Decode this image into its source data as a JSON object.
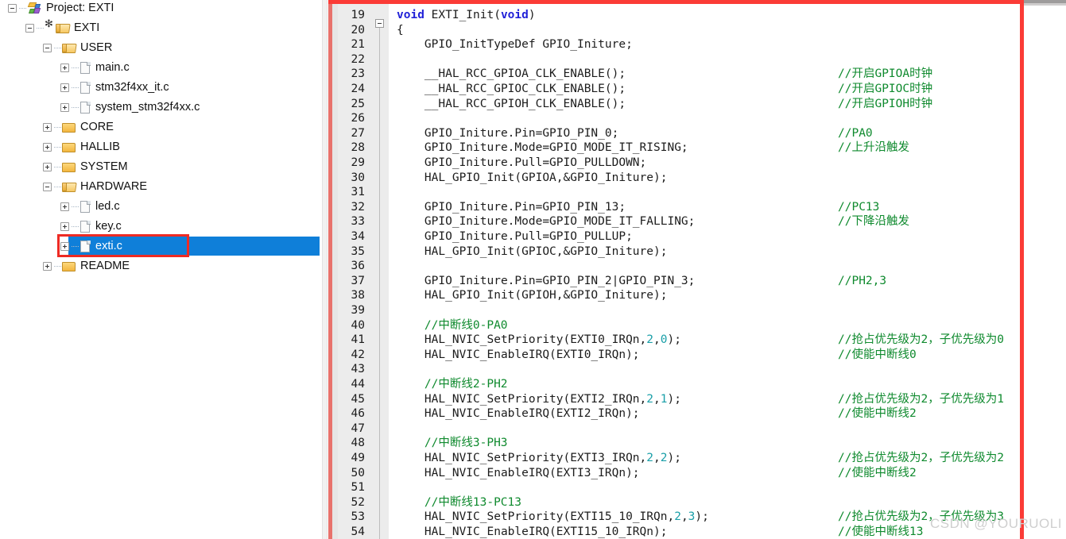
{
  "window": {
    "annotation_color": "#fb3b36",
    "selection_color": "#0f7fd9",
    "watermark": "CSDN @YOURUOLI"
  },
  "tree": {
    "root_label": "Project: EXTI",
    "nodes": [
      {
        "label": "Project: EXTI",
        "icon": "project-icon",
        "depth": 0,
        "expander": "minus",
        "selected": false
      },
      {
        "label": "EXTI",
        "icon": "target-folder-icon",
        "depth": 1,
        "expander": "minus",
        "selected": false
      },
      {
        "label": "USER",
        "icon": "folder-open-icon",
        "depth": 2,
        "expander": "minus",
        "selected": false
      },
      {
        "label": "main.c",
        "icon": "file-icon",
        "depth": 3,
        "expander": "plus",
        "selected": false
      },
      {
        "label": "stm32f4xx_it.c",
        "icon": "file-icon",
        "depth": 3,
        "expander": "plus",
        "selected": false
      },
      {
        "label": "system_stm32f4xx.c",
        "icon": "file-icon",
        "depth": 3,
        "expander": "plus",
        "selected": false
      },
      {
        "label": "CORE",
        "icon": "folder-icon",
        "depth": 2,
        "expander": "plus",
        "selected": false
      },
      {
        "label": "HALLIB",
        "icon": "folder-icon",
        "depth": 2,
        "expander": "plus",
        "selected": false
      },
      {
        "label": "SYSTEM",
        "icon": "folder-icon",
        "depth": 2,
        "expander": "plus",
        "selected": false
      },
      {
        "label": "HARDWARE",
        "icon": "folder-open-icon",
        "depth": 2,
        "expander": "minus",
        "selected": false
      },
      {
        "label": "led.c",
        "icon": "file-icon",
        "depth": 3,
        "expander": "plus",
        "selected": false
      },
      {
        "label": "key.c",
        "icon": "file-icon",
        "depth": 3,
        "expander": "plus",
        "selected": false
      },
      {
        "label": "exti.c",
        "icon": "file-icon",
        "depth": 3,
        "expander": "plus",
        "selected": true
      },
      {
        "label": "README",
        "icon": "folder-icon",
        "depth": 2,
        "expander": "plus",
        "selected": false
      }
    ]
  },
  "editor": {
    "first_line_number": 19,
    "lines": [
      {
        "n": 19,
        "code": "void EXTI_Init(void)",
        "comment": ""
      },
      {
        "n": 20,
        "code": "{",
        "comment": ""
      },
      {
        "n": 21,
        "code": "    GPIO_InitTypeDef GPIO_Initure;",
        "comment": ""
      },
      {
        "n": 22,
        "code": "",
        "comment": ""
      },
      {
        "n": 23,
        "code": "    __HAL_RCC_GPIOA_CLK_ENABLE();",
        "comment": "//开启GPIOA时钟"
      },
      {
        "n": 24,
        "code": "    __HAL_RCC_GPIOC_CLK_ENABLE();",
        "comment": "//开启GPIOC时钟"
      },
      {
        "n": 25,
        "code": "    __HAL_RCC_GPIOH_CLK_ENABLE();",
        "comment": "//开启GPIOH时钟"
      },
      {
        "n": 26,
        "code": "",
        "comment": ""
      },
      {
        "n": 27,
        "code": "    GPIO_Initure.Pin=GPIO_PIN_0;",
        "comment": "//PA0"
      },
      {
        "n": 28,
        "code": "    GPIO_Initure.Mode=GPIO_MODE_IT_RISING;",
        "comment": "//上升沿触发"
      },
      {
        "n": 29,
        "code": "    GPIO_Initure.Pull=GPIO_PULLDOWN;",
        "comment": ""
      },
      {
        "n": 30,
        "code": "    HAL_GPIO_Init(GPIOA,&GPIO_Initure);",
        "comment": ""
      },
      {
        "n": 31,
        "code": "",
        "comment": ""
      },
      {
        "n": 32,
        "code": "    GPIO_Initure.Pin=GPIO_PIN_13;",
        "comment": "//PC13"
      },
      {
        "n": 33,
        "code": "    GPIO_Initure.Mode=GPIO_MODE_IT_FALLING;",
        "comment": "//下降沿触发"
      },
      {
        "n": 34,
        "code": "    GPIO_Initure.Pull=GPIO_PULLUP;",
        "comment": ""
      },
      {
        "n": 35,
        "code": "    HAL_GPIO_Init(GPIOC,&GPIO_Initure);",
        "comment": ""
      },
      {
        "n": 36,
        "code": "",
        "comment": ""
      },
      {
        "n": 37,
        "code": "    GPIO_Initure.Pin=GPIO_PIN_2|GPIO_PIN_3;",
        "comment": "//PH2,3"
      },
      {
        "n": 38,
        "code": "    HAL_GPIO_Init(GPIOH,&GPIO_Initure);",
        "comment": ""
      },
      {
        "n": 39,
        "code": "",
        "comment": ""
      },
      {
        "n": 40,
        "code": "    //中断线0-PA0",
        "comment": ""
      },
      {
        "n": 41,
        "code": "    HAL_NVIC_SetPriority(EXTI0_IRQn,2,0);",
        "comment": "//抢占优先级为2，子优先级为0"
      },
      {
        "n": 42,
        "code": "    HAL_NVIC_EnableIRQ(EXTI0_IRQn);",
        "comment": "//使能中断线0"
      },
      {
        "n": 43,
        "code": "",
        "comment": ""
      },
      {
        "n": 44,
        "code": "    //中断线2-PH2",
        "comment": ""
      },
      {
        "n": 45,
        "code": "    HAL_NVIC_SetPriority(EXTI2_IRQn,2,1);",
        "comment": "//抢占优先级为2，子优先级为1"
      },
      {
        "n": 46,
        "code": "    HAL_NVIC_EnableIRQ(EXTI2_IRQn);",
        "comment": "//使能中断线2"
      },
      {
        "n": 47,
        "code": "",
        "comment": ""
      },
      {
        "n": 48,
        "code": "    //中断线3-PH3",
        "comment": ""
      },
      {
        "n": 49,
        "code": "    HAL_NVIC_SetPriority(EXTI3_IRQn,2,2);",
        "comment": "//抢占优先级为2，子优先级为2"
      },
      {
        "n": 50,
        "code": "    HAL_NVIC_EnableIRQ(EXTI3_IRQn);",
        "comment": "//使能中断线2"
      },
      {
        "n": 51,
        "code": "",
        "comment": ""
      },
      {
        "n": 52,
        "code": "    //中断线13-PC13",
        "comment": ""
      },
      {
        "n": 53,
        "code": "    HAL_NVIC_SetPriority(EXTI15_10_IRQn,2,3);",
        "comment": "//抢占优先级为2，子优先级为3"
      },
      {
        "n": 54,
        "code": "    HAL_NVIC_EnableIRQ(EXTI15_10_IRQn);",
        "comment": "//使能中断线13"
      }
    ]
  }
}
